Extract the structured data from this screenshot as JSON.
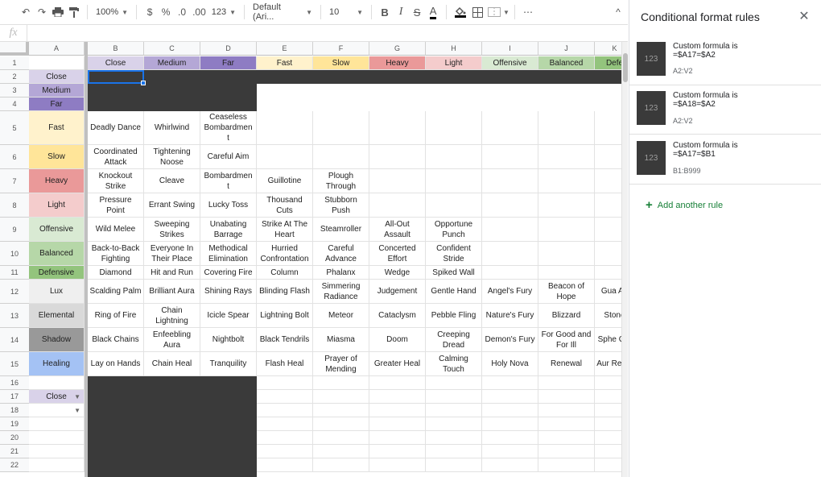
{
  "toolbar": {
    "zoom": "100%",
    "currency": "$",
    "percent": "%",
    "dec_decrease": ".0",
    "dec_increase": ".00",
    "number_format": "123",
    "font": "Default (Ari...",
    "font_size": "10",
    "bold": "B",
    "italic": "I",
    "strike": "S",
    "text_color": "A",
    "more": "⋯",
    "collapse": "^"
  },
  "formula_bar": {
    "fx": "fx",
    "value": ""
  },
  "columns": [
    "A",
    "B",
    "C",
    "D",
    "E",
    "F",
    "G",
    "H",
    "I",
    "J",
    "K"
  ],
  "rows": [
    "1",
    "2",
    "3",
    "4",
    "5",
    "6",
    "7",
    "8",
    "9",
    "10",
    "11",
    "12",
    "13",
    "14",
    "15",
    "16",
    "17",
    "18",
    "19",
    "20",
    "21",
    "22"
  ],
  "colors": {
    "close": "#d9d2e9",
    "medium": "#b4a7d6",
    "far": "#8e7cc3",
    "fast": "#fff2cc",
    "slow": "#ffe599",
    "heavy": "#ea9999",
    "light": "#f4cccc",
    "offensive": "#d9ead3",
    "balanced": "#b6d7a8",
    "defensive": "#93c47d",
    "lux": "#efefef",
    "elemental": "#d9d9d9",
    "shadow": "#999999",
    "healing": "#a4c2f4",
    "dark": "#3a3a3a",
    "accent": "#1a73e8",
    "add_green": "#188038"
  },
  "header_row": [
    "Close",
    "Medium",
    "Far",
    "Fast",
    "Slow",
    "Heavy",
    "Light",
    "Offensive",
    "Balanced",
    "Defe"
  ],
  "row_labels": [
    "Close",
    "Medium",
    "Far",
    "Fast",
    "Slow",
    "Heavy",
    "Light",
    "Offensive",
    "Balanced",
    "Defensive",
    "Lux",
    "Elemental",
    "Shadow",
    "Healing"
  ],
  "body": {
    "r5": [
      "Deadly Dance",
      "Whirlwind",
      "Ceaseless Bombardmen t",
      "",
      "",
      "",
      "",
      "",
      "",
      ""
    ],
    "r6": [
      "Coordinated Attack",
      "Tightening Noose",
      "Careful Aim",
      "",
      "",
      "",
      "",
      "",
      "",
      ""
    ],
    "r7": [
      "Knockout Strike",
      "Cleave",
      "Bombardmen t",
      "Guillotine",
      "Plough Through",
      "",
      "",
      "",
      "",
      ""
    ],
    "r8": [
      "Pressure Point",
      "Errant Swing",
      "Lucky Toss",
      "Thousand Cuts",
      "Stubborn Push",
      "",
      "",
      "",
      "",
      ""
    ],
    "r9": [
      "Wild Melee",
      "Sweeping Strikes",
      "Unabating Barrage",
      "Strike At The Heart",
      "Steamroller",
      "All-Out Assault",
      "Opportune Punch",
      "",
      "",
      ""
    ],
    "r10": [
      "Back-to-Back Fighting",
      "Everyone In Their Place",
      "Methodical Elimination",
      "Hurried Confrontation",
      "Careful Advance",
      "Concerted Effort",
      "Confident Stride",
      "",
      "",
      ""
    ],
    "r11": [
      "Diamond",
      "Hit and Run",
      "Covering Fire",
      "Column",
      "Phalanx",
      "Wedge",
      "Spiked Wall",
      "",
      "",
      ""
    ],
    "r12": [
      "Scalding Palm",
      "Brilliant Aura",
      "Shining Rays",
      "Blinding Flash",
      "Simmering Radiance",
      "Judgement",
      "Gentle Hand",
      "Angel's Fury",
      "Beacon of Hope",
      "Gua An"
    ],
    "r13": [
      "Ring of Fire",
      "Chain Lightning",
      "Icicle Spear",
      "Lightning Bolt",
      "Meteor",
      "Cataclysm",
      "Pebble Fling",
      "Nature's Fury",
      "Blizzard",
      "Stone"
    ],
    "r14": [
      "Black Chains",
      "Enfeebling Aura",
      "Nightbolt",
      "Black Tendrils",
      "Miasma",
      "Doom",
      "Creeping Dread",
      "Demon's Fury",
      "For Good and For Ill",
      "Sphe Glo"
    ],
    "r15": [
      "Lay on Hands",
      "Chain Heal",
      "Tranquility",
      "Flash Heal",
      "Prayer of Mending",
      "Greater Heal",
      "Calming Touch",
      "Holy Nova",
      "Renewal",
      "Aur Resto"
    ]
  },
  "dropdown": {
    "a17": "Close",
    "a18": ""
  },
  "panel": {
    "title": "Conditional format rules",
    "close": "✕",
    "rules": [
      {
        "swatch": "123",
        "line1": "Custom formula is",
        "line2": "=$A17=$A2",
        "range": "A2:V2"
      },
      {
        "swatch": "123",
        "line1": "Custom formula is",
        "line2": "=$A18=$A2",
        "range": "A2:V2"
      },
      {
        "swatch": "123",
        "line1": "Custom formula is",
        "line2": "=$A17=$B1",
        "range": "B1:B999"
      }
    ],
    "add_rule": "Add another rule"
  }
}
